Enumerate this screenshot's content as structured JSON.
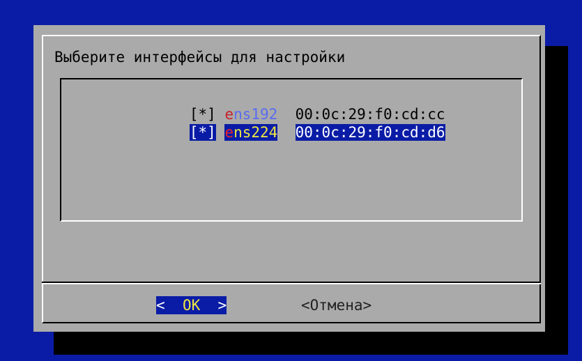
{
  "dialog": {
    "title": "Выберите интерфейсы для настройки",
    "interfaces": [
      {
        "checkbox": "[*]",
        "name_first": "e",
        "name_rest": "ns192",
        "mac": "00:0c:29:f0:cd:cc",
        "selected": false
      },
      {
        "checkbox": "[*]",
        "name_first": "e",
        "name_rest": "ns224",
        "mac": "00:0c:29:f0:cd:d6",
        "selected": true
      }
    ],
    "buttons": {
      "ok_left": "<",
      "ok_label": "OK",
      "ok_right": ">",
      "cancel_label": "<Отмена>"
    }
  },
  "colors": {
    "background": "#0a1ca6",
    "dialog": "#aaaaaa",
    "highlight": "#0a1ca6",
    "hotkey_red": "#c8202a",
    "name_blue": "#5a6cf0",
    "name_yellow": "#f0e840"
  }
}
